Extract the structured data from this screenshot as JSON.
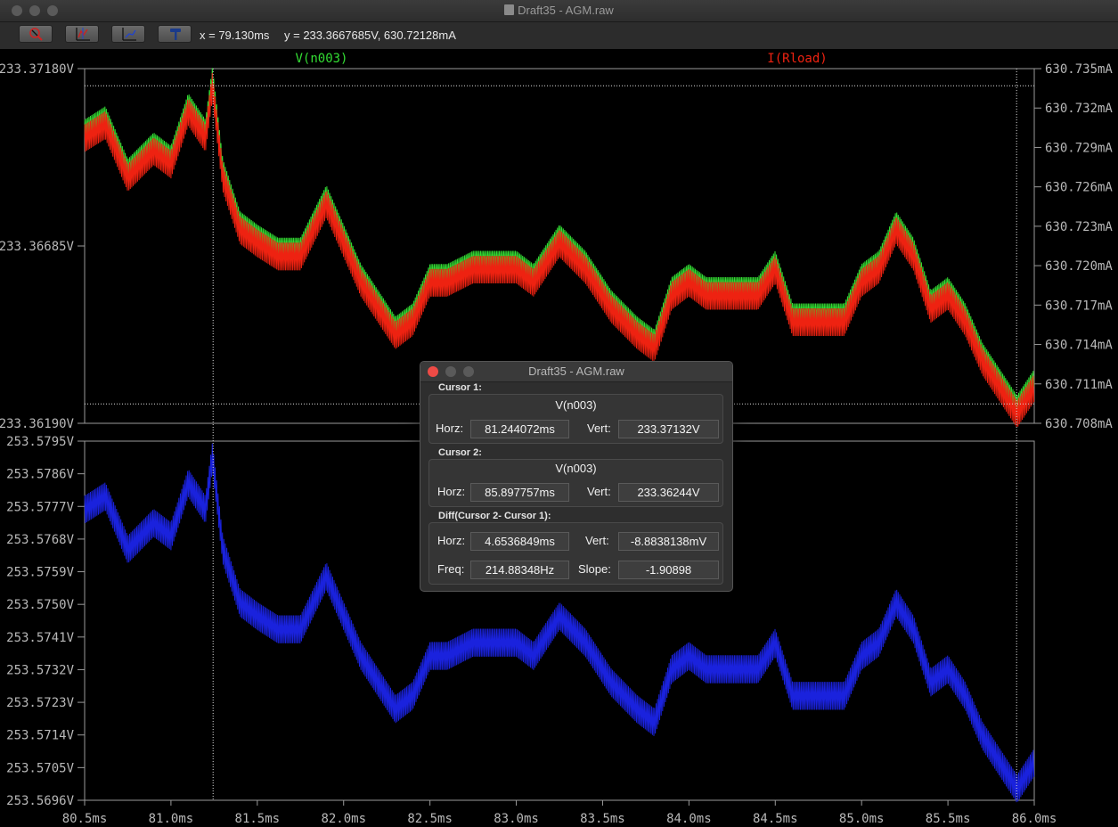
{
  "window": {
    "title": "Draft35 - AGM.raw"
  },
  "toolbar": {
    "buttons": [
      {
        "icon": "zoom-cancel-icon"
      },
      {
        "icon": "autorange-icon"
      },
      {
        "icon": "zoom-out-icon"
      },
      {
        "icon": "hammer-icon"
      }
    ],
    "x_readout": "x = 79.130ms",
    "y_readout": "y = 233.3667685V, 630.72128mA"
  },
  "colors": {
    "v_trace": "#33dd33",
    "i_trace": "#ee2211",
    "bottom_trace": "#1a22dd",
    "axis_text": "#b8b8b8",
    "grid": "#9a9a9a"
  },
  "cursor_dialog": {
    "title": "Draft35 - AGM.raw",
    "cursor1": {
      "label": "Cursor 1:",
      "trace": "V(n003)",
      "horz_label": "Horz:",
      "horz": "81.244072ms",
      "vert_label": "Vert:",
      "vert": "233.37132V"
    },
    "cursor2": {
      "label": "Cursor 2:",
      "trace": "V(n003)",
      "horz_label": "Horz:",
      "horz": "85.897757ms",
      "vert_label": "Vert:",
      "vert": "233.36244V"
    },
    "diff": {
      "label": "Diff(Cursor 2- Cursor 1):",
      "horz_label": "Horz:",
      "horz": "4.6536849ms",
      "vert_label": "Vert:",
      "vert": "-8.8838138mV",
      "freq_label": "Freq:",
      "freq": "214.88348Hz",
      "slope_label": "Slope:",
      "slope": "-1.90898"
    }
  },
  "chart_data": [
    {
      "type": "line",
      "series": [
        {
          "name": "V(n003)",
          "axis": "left",
          "color": "#33dd33"
        },
        {
          "name": "I(Rload)",
          "axis": "right",
          "color": "#ee2211"
        }
      ],
      "xlim": [
        80.5,
        86.0
      ],
      "x_tick_labels": [
        "80.5ms",
        "81.0ms",
        "81.5ms",
        "82.0ms",
        "82.5ms",
        "83.0ms",
        "83.5ms",
        "84.0ms",
        "84.5ms",
        "85.0ms",
        "85.5ms",
        "86.0ms"
      ],
      "y_left_lim": [
        233.3619,
        233.3718
      ],
      "y_left_tick_labels": [
        "233.37180V",
        "233.36685V",
        "233.36190V"
      ],
      "y_right_lim": [
        630.708,
        630.735
      ],
      "y_right_tick_labels": [
        "630.735mA",
        "630.732mA",
        "630.729mA",
        "630.726mA",
        "630.723mA",
        "630.720mA",
        "630.717mA",
        "630.714mA",
        "630.711mA",
        "630.708mA"
      ],
      "cursors_x": [
        81.244072,
        85.897757
      ],
      "cursor_y_levels": [
        233.37132,
        233.36244
      ],
      "envelope_x": [
        80.5,
        80.62,
        80.75,
        80.9,
        81.0,
        81.1,
        81.2,
        81.24,
        81.3,
        81.4,
        81.5,
        81.62,
        81.75,
        81.9,
        82.0,
        82.1,
        82.2,
        82.3,
        82.4,
        82.5,
        82.6,
        82.75,
        82.9,
        83.0,
        83.1,
        83.25,
        83.4,
        83.55,
        83.7,
        83.8,
        83.9,
        84.0,
        84.1,
        84.2,
        84.3,
        84.4,
        84.5,
        84.6,
        84.7,
        84.8,
        84.9,
        85.0,
        85.1,
        85.2,
        85.3,
        85.4,
        85.5,
        85.6,
        85.7,
        85.8,
        85.9,
        86.0
      ],
      "envelope_y_mA": [
        630.73,
        630.731,
        630.727,
        630.729,
        630.728,
        630.732,
        630.73,
        630.734,
        630.727,
        630.723,
        630.722,
        630.721,
        630.721,
        630.725,
        630.722,
        630.719,
        630.717,
        630.715,
        630.716,
        630.719,
        630.719,
        630.72,
        630.72,
        630.72,
        630.719,
        630.722,
        630.72,
        630.717,
        630.715,
        630.714,
        630.718,
        630.719,
        630.718,
        630.718,
        630.718,
        630.718,
        630.72,
        630.716,
        630.716,
        630.716,
        630.716,
        630.719,
        630.72,
        630.723,
        630.721,
        630.717,
        630.718,
        630.716,
        630.713,
        630.711,
        630.709,
        630.711
      ],
      "ripple_mA": 0.0015
    },
    {
      "type": "line",
      "series": [
        {
          "name": "",
          "axis": "left",
          "color": "#1a22dd"
        }
      ],
      "xlim": [
        80.5,
        86.0
      ],
      "ylim": [
        253.5696,
        253.5795
      ],
      "y_tick_labels": [
        "253.5795V",
        "253.5786V",
        "253.5777V",
        "253.5768V",
        "253.5759V",
        "253.5750V",
        "253.5741V",
        "253.5732V",
        "253.5723V",
        "253.5714V",
        "253.5705V",
        "253.5696V"
      ]
    }
  ]
}
